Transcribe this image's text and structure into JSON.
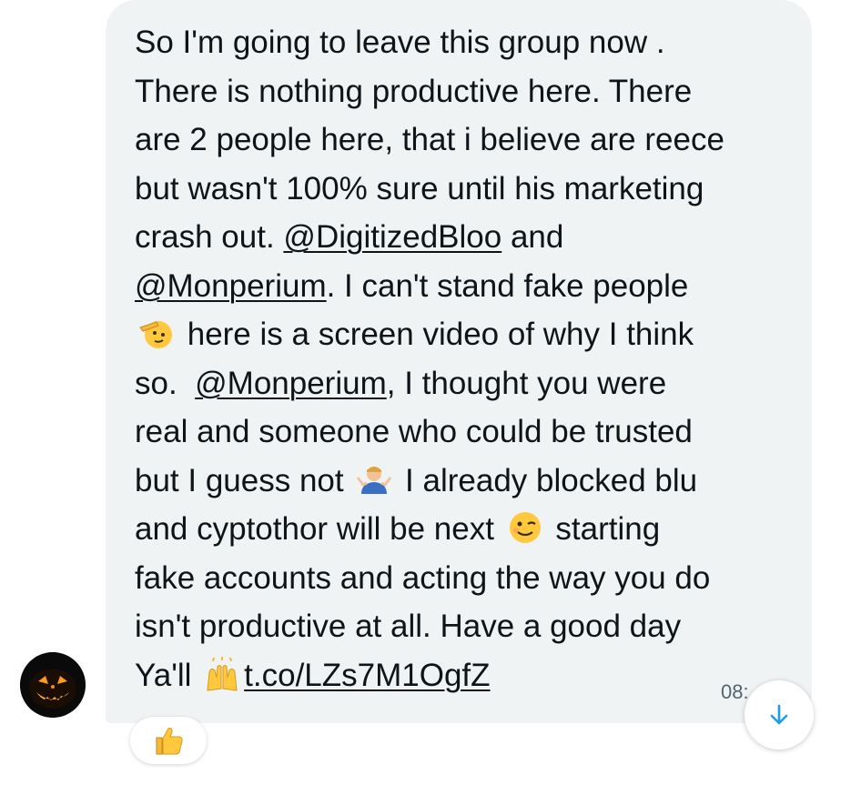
{
  "message": {
    "lines": [
      [
        "So I'm going to leave this group now ."
      ],
      [
        "There is nothing productive here. There"
      ],
      [
        "are 2 people here, that i believe are reece"
      ],
      [
        "but wasn't 100% sure until his marketing"
      ],
      [
        "crash out. ",
        "@DigitizedBloo",
        " and"
      ],
      [
        "@Monperium",
        ". I can't stand fake people"
      ],
      [
        " here is a screen video of why I think"
      ],
      [
        "so.  ",
        "@Monperium",
        ", I thought you were"
      ],
      [
        "real and someone who could be trusted"
      ],
      [
        "but I guess not ",
        " I already blocked blu"
      ],
      [
        "and cyptothor will be next ",
        " starting"
      ],
      [
        "fake accounts and acting the way you do"
      ],
      [
        "isn't productive at all. Have a good day"
      ],
      [
        "Ya'll ",
        "t.co/LZs7M1OgfZ"
      ]
    ],
    "mention_1": "@DigitizedBloo",
    "mention_2": "@Monperium",
    "link": "t.co/LZs7M1OgfZ",
    "timestamp": "08:"
  },
  "icons": {
    "saluting": "saluting-face-icon",
    "shrug": "person-shrugging-icon",
    "wink": "winking-face-icon",
    "raised_hands": "raising-hands-icon",
    "reaction": "thumbs-up-icon",
    "scroll": "arrow-down-icon",
    "avatar": "jack-o-lantern-avatar"
  },
  "colors": {
    "bubble": "#eff3f4",
    "text": "#0f1419",
    "accent": "#1d9bf0",
    "timestamp": "#536471"
  }
}
